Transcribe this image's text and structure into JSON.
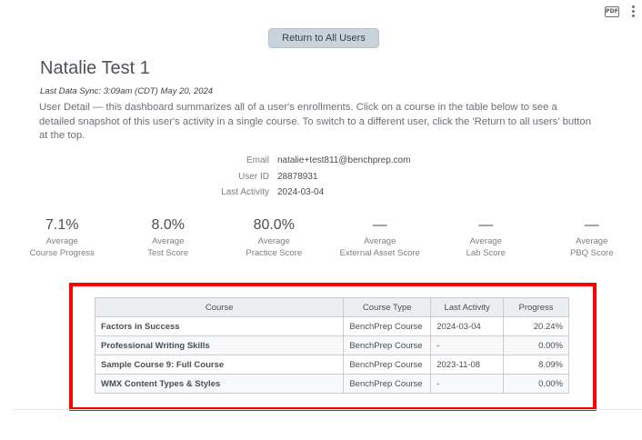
{
  "toolbar": {
    "pdf_label": "PDF",
    "more_icon": "kebab-icon"
  },
  "return_button": "Return to All Users",
  "user": {
    "name": "Natalie Test 1",
    "last_sync": "Last Data Sync: 3:09am (CDT) May 20, 2024",
    "description": "User Detail — this dashboard summarizes all of a user's enrollments. Click on a course in the table below to see a detailed snapshot of this user's activity in a single course. To switch to a different user, click the 'Return to all users' button at the top."
  },
  "info": [
    {
      "label": "Email",
      "value": "natalie+test811@benchprep.com"
    },
    {
      "label": "User ID",
      "value": "28878931"
    },
    {
      "label": "Last Activity",
      "value": "2024-03-04"
    }
  ],
  "stats": [
    {
      "value": "7.1%",
      "label1": "Average",
      "label2": "Course Progress"
    },
    {
      "value": "8.0%",
      "label1": "Average",
      "label2": "Test Score"
    },
    {
      "value": "80.0%",
      "label1": "Average",
      "label2": "Practice Score"
    },
    {
      "value": "—",
      "label1": "Average",
      "label2": "External Asset Score"
    },
    {
      "value": "—",
      "label1": "Average",
      "label2": "Lab Score"
    },
    {
      "value": "—",
      "label1": "Average",
      "label2": "PBQ Score"
    }
  ],
  "table": {
    "headers": [
      "Course",
      "Course Type",
      "Last Activity",
      "Progress"
    ],
    "rows": [
      {
        "course": "Factors in Success",
        "type": "BenchPrep Course",
        "last_activity": "2024-03-04",
        "progress": "20.24%"
      },
      {
        "course": "Professional Writing Skills",
        "type": "BenchPrep Course",
        "last_activity": "-",
        "progress": "0.00%"
      },
      {
        "course": "Sample Course 9: Full Course",
        "type": "BenchPrep Course",
        "last_activity": "2023-11-08",
        "progress": "8.09%"
      },
      {
        "course": "WMX Content Types & Styles",
        "type": "BenchPrep Course",
        "last_activity": "-",
        "progress": "0.00%"
      }
    ]
  },
  "colors": {
    "highlight": "#ff0000",
    "link": "#2a7bbf",
    "button_bg": "#c9d3dc"
  }
}
